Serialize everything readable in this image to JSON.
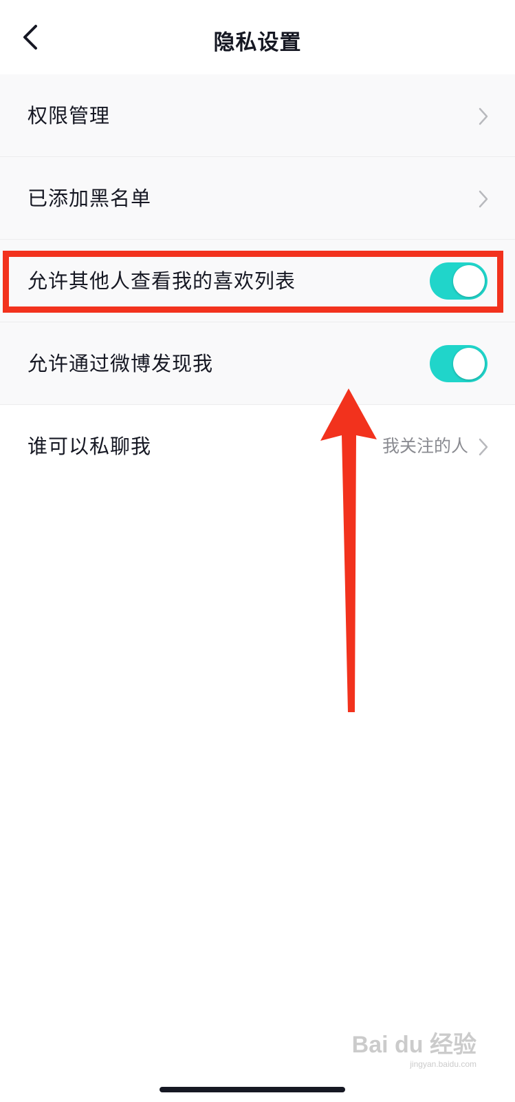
{
  "header": {
    "title": "隐私设置",
    "back_icon": "chevron-left-icon"
  },
  "settings": [
    {
      "label": "权限管理",
      "control": "chevron",
      "icon": "chevron-right-icon"
    },
    {
      "label": "已添加黑名单",
      "control": "chevron",
      "icon": "chevron-right-icon"
    },
    {
      "label": "允许其他人查看我的喜欢列表",
      "control": "toggle",
      "on": true
    },
    {
      "label": "允许通过微博发现我",
      "control": "toggle",
      "on": true
    },
    {
      "label": "谁可以私聊我",
      "value": "我关注的人",
      "control": "chevron",
      "icon": "chevron-right-icon"
    }
  ],
  "colors": {
    "toggle_on": "#20d5ca",
    "annotation": "#f2321d",
    "row_bg": "#f9f9fa",
    "text": "#161823",
    "secondary_text": "#8a8b91"
  },
  "watermark": {
    "logo": "Bai du 经验",
    "url": "jingyan.baidu.com"
  }
}
